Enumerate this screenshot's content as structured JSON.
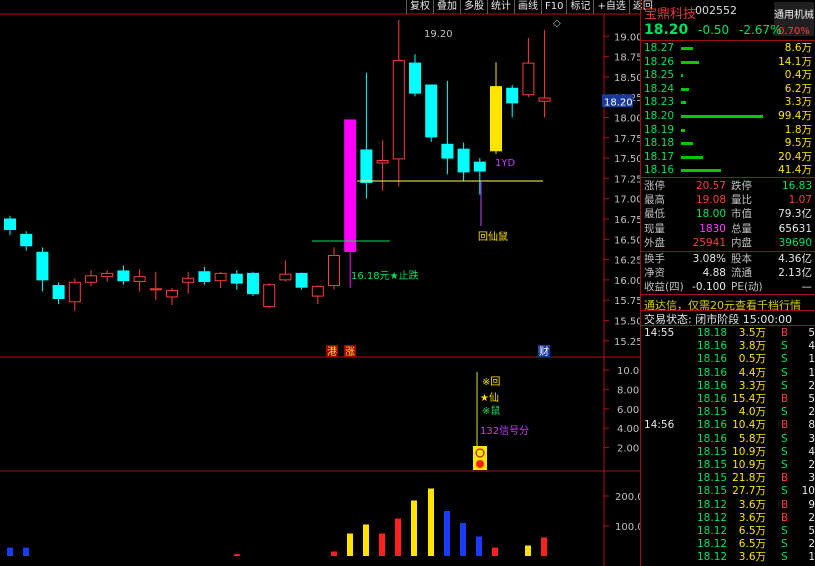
{
  "toolbar": [
    "复权",
    "叠加",
    "多股",
    "统计",
    "画线",
    "F10",
    "标记",
    "+自选",
    "返回"
  ],
  "stock": {
    "name": "宝鼎科技",
    "code": "002552",
    "sector": "通用机械",
    "sector_pct": "0.70%",
    "price": "18.20",
    "change": "-0.50",
    "change_pct": "-2.67%"
  },
  "asks": [
    {
      "label": "18.27",
      "vol": "8.6万",
      "bar": 12
    },
    {
      "label": "18.26",
      "vol": "14.1万",
      "bar": 18
    },
    {
      "label": "18.25",
      "vol": "0.4万",
      "bar": 2
    },
    {
      "label": "18.24",
      "vol": "6.2万",
      "bar": 8
    },
    {
      "label": "18.23",
      "vol": "3.3万",
      "bar": 5
    }
  ],
  "bids": [
    {
      "label": "18.20",
      "vol": "99.4万",
      "bar": 82
    },
    {
      "label": "18.19",
      "vol": "1.8万",
      "bar": 4
    },
    {
      "label": "18.18",
      "vol": "9.5万",
      "bar": 12
    },
    {
      "label": "18.17",
      "vol": "20.4万",
      "bar": 22
    },
    {
      "label": "18.16",
      "vol": "41.4万",
      "bar": 40
    }
  ],
  "stats": [
    {
      "l1": "涨停",
      "v1": "20.57",
      "c1": "rd",
      "l2": "跌停",
      "v2": "16.83",
      "c2": "gr"
    },
    {
      "l1": "最高",
      "v1": "19.08",
      "c1": "rd",
      "l2": "量比",
      "v2": "1.07",
      "c2": "rd"
    },
    {
      "l1": "最低",
      "v1": "18.00",
      "c1": "gr",
      "l2": "市值",
      "v2": "79.3亿",
      "c2": "wh"
    },
    {
      "l1": "现量",
      "v1": "1830",
      "c1": "mg",
      "l2": "总量",
      "v2": "65631",
      "c2": "wh"
    },
    {
      "l1": "外盘",
      "v1": "25941",
      "c1": "rd",
      "l2": "内盘",
      "v2": "39690",
      "c2": "gr"
    }
  ],
  "stats2": [
    {
      "l1": "换手",
      "v1": "3.08%",
      "l2": "股本",
      "v2": "4.36亿"
    },
    {
      "l1": "净资",
      "v1": "4.88",
      "l2": "流通",
      "v2": "2.13亿"
    },
    {
      "l1": "收益(四)",
      "v1": "-0.100",
      "l2": "PE(动)",
      "v2": "—"
    }
  ],
  "ad_text": "通达信，仅需20元查看千档行情",
  "trade_status": "交易状态: 闭市阶段 15:00:00",
  "ticks": [
    {
      "t": "14:55",
      "p": "18.18",
      "v": "3.5万",
      "s": "B",
      "n": "5"
    },
    {
      "t": "",
      "p": "18.16",
      "v": "3.8万",
      "s": "S",
      "n": "4"
    },
    {
      "t": "",
      "p": "18.16",
      "v": "0.5万",
      "s": "S",
      "n": "1"
    },
    {
      "t": "",
      "p": "18.16",
      "v": "4.4万",
      "s": "S",
      "n": "1"
    },
    {
      "t": "",
      "p": "18.16",
      "v": "3.3万",
      "s": "S",
      "n": "2"
    },
    {
      "t": "",
      "p": "18.16",
      "v": "15.4万",
      "s": "B",
      "n": "5"
    },
    {
      "t": "",
      "p": "18.15",
      "v": "4.0万",
      "s": "S",
      "n": "2"
    },
    {
      "t": "14:56",
      "p": "18.16",
      "v": "10.4万",
      "s": "B",
      "n": "8"
    },
    {
      "t": "",
      "p": "18.16",
      "v": "5.8万",
      "s": "S",
      "n": "3"
    },
    {
      "t": "",
      "p": "18.15",
      "v": "10.9万",
      "s": "S",
      "n": "4"
    },
    {
      "t": "",
      "p": "18.15",
      "v": "10.9万",
      "s": "S",
      "n": "2"
    },
    {
      "t": "",
      "p": "18.15",
      "v": "21.8万",
      "s": "B",
      "n": "3"
    },
    {
      "t": "",
      "p": "18.15",
      "v": "27.7万",
      "s": "S",
      "n": "10"
    },
    {
      "t": "",
      "p": "18.12",
      "v": "3.6万",
      "s": "B",
      "n": "9"
    },
    {
      "t": "",
      "p": "18.12",
      "v": "3.6万",
      "s": "B",
      "n": "2"
    },
    {
      "t": "",
      "p": "18.12",
      "v": "6.5万",
      "s": "S",
      "n": "5"
    },
    {
      "t": "",
      "p": "18.12",
      "v": "6.5万",
      "s": "S",
      "n": "2"
    },
    {
      "t": "",
      "p": "18.12",
      "v": "3.6万",
      "s": "S",
      "n": "1"
    }
  ],
  "chart_data": {
    "type": "candlestick",
    "y_ticks": [
      "19.00",
      "18.75",
      "18.50",
      "18.25",
      "18.00",
      "17.75",
      "17.50",
      "17.25",
      "17.00",
      "16.75",
      "16.50",
      "16.25",
      "16.00",
      "15.75",
      "15.50",
      "15.25"
    ],
    "y_range": [
      15.05,
      19.25
    ],
    "last_price_label": "18.20",
    "candles": [
      {
        "o": 16.75,
        "c": 16.62,
        "h": 16.79,
        "l": 16.55,
        "up": false
      },
      {
        "o": 16.56,
        "c": 16.42,
        "h": 16.6,
        "l": 16.36,
        "up": false
      },
      {
        "o": 16.34,
        "c": 16.0,
        "h": 16.4,
        "l": 15.86,
        "up": false
      },
      {
        "o": 15.93,
        "c": 15.77,
        "h": 15.97,
        "l": 15.7,
        "up": false
      },
      {
        "o": 15.73,
        "c": 15.97,
        "h": 16.02,
        "l": 15.62,
        "up": true
      },
      {
        "o": 15.97,
        "c": 16.05,
        "h": 16.12,
        "l": 15.92,
        "up": true
      },
      {
        "o": 16.04,
        "c": 16.08,
        "h": 16.12,
        "l": 15.98,
        "up": true
      },
      {
        "o": 16.11,
        "c": 15.99,
        "h": 16.18,
        "l": 15.94,
        "up": false
      },
      {
        "o": 15.98,
        "c": 16.04,
        "h": 16.13,
        "l": 15.86,
        "up": true
      },
      {
        "o": 15.88,
        "c": 15.89,
        "h": 16.1,
        "l": 15.75,
        "up": true
      },
      {
        "o": 15.79,
        "c": 15.87,
        "h": 15.9,
        "l": 15.69,
        "up": true
      },
      {
        "o": 15.97,
        "c": 16.02,
        "h": 16.1,
        "l": 15.83,
        "up": true
      },
      {
        "o": 16.1,
        "c": 15.98,
        "h": 16.16,
        "l": 15.94,
        "up": false
      },
      {
        "o": 15.99,
        "c": 16.08,
        "h": 16.1,
        "l": 15.9,
        "up": true
      },
      {
        "o": 16.07,
        "c": 15.96,
        "h": 16.12,
        "l": 15.88,
        "up": false
      },
      {
        "o": 16.08,
        "c": 15.83,
        "h": 16.1,
        "l": 15.8,
        "up": false
      },
      {
        "o": 15.67,
        "c": 15.94,
        "h": 15.96,
        "l": 15.65,
        "up": true
      },
      {
        "o": 16.0,
        "c": 16.07,
        "h": 16.24,
        "l": 15.98,
        "up": true
      },
      {
        "o": 16.08,
        "c": 15.91,
        "h": 16.09,
        "l": 15.88,
        "up": false
      },
      {
        "o": 15.8,
        "c": 15.92,
        "h": 15.93,
        "l": 15.7,
        "up": true
      },
      {
        "o": 15.93,
        "c": 16.3,
        "h": 16.4,
        "l": 15.88,
        "up": true
      },
      {
        "o": 16.35,
        "c": 17.97,
        "h": 17.97,
        "l": 15.9,
        "up": true,
        "limit": true
      },
      {
        "o": 17.6,
        "c": 17.2,
        "h": 18.55,
        "l": 17.0,
        "up": false
      },
      {
        "o": 17.47,
        "c": 17.44,
        "h": 17.72,
        "l": 17.1,
        "up": true
      },
      {
        "o": 17.49,
        "c": 18.7,
        "h": 19.2,
        "l": 17.15,
        "up": true
      },
      {
        "o": 18.67,
        "c": 18.3,
        "h": 18.78,
        "l": 18.26,
        "up": false
      },
      {
        "o": 18.4,
        "c": 17.76,
        "h": 18.4,
        "l": 17.7,
        "up": false
      },
      {
        "o": 17.67,
        "c": 17.5,
        "h": 18.45,
        "l": 17.3,
        "up": false
      },
      {
        "o": 17.61,
        "c": 17.33,
        "h": 17.69,
        "l": 17.22,
        "up": false
      },
      {
        "o": 17.45,
        "c": 17.34,
        "h": 17.5,
        "l": 17.05,
        "up": false
      },
      {
        "o": 17.59,
        "c": 18.38,
        "h": 18.68,
        "l": 17.55,
        "up": true,
        "yellow": true
      },
      {
        "o": 18.36,
        "c": 18.18,
        "h": 18.4,
        "l": 18.0,
        "up": false
      },
      {
        "o": 18.28,
        "c": 18.67,
        "h": 18.98,
        "l": 18.25,
        "up": true
      },
      {
        "o": 18.2,
        "c": 18.24,
        "h": 19.08,
        "l": 18.0,
        "up": true
      }
    ],
    "annotations": [
      {
        "text": "19.20",
        "color": "#c0c0c0"
      },
      {
        "text": "1YD",
        "color": "#c040ff"
      },
      {
        "text": "回仙鼠",
        "color": "#ffe400"
      },
      {
        "text": "16.18元★止跌",
        "color": "#00e060"
      }
    ],
    "markers": [
      "港",
      "涨",
      "财"
    ],
    "signal": {
      "y_ticks": [
        "10.00",
        "8.00",
        "6.00",
        "4.00",
        "2.00"
      ],
      "labels": [
        "※回",
        "★仙",
        "※鼠",
        "132信号分"
      ]
    },
    "volume": {
      "y_ticks": [
        "200.0",
        "100.0"
      ],
      "bars": [
        {
          "v": 28,
          "c": "#1a3cff"
        },
        {
          "v": 28,
          "c": "#1a3cff"
        },
        {
          "v": 6,
          "c": "#ff2020"
        },
        {
          "v": 15,
          "c": "#ff2020"
        },
        {
          "v": 75,
          "c": "#ffe400"
        },
        {
          "v": 105,
          "c": "#ffe400"
        },
        {
          "v": 75,
          "c": "#ff2020"
        },
        {
          "v": 125,
          "c": "#ff2020"
        },
        {
          "v": 185,
          "c": "#ffe400"
        },
        {
          "v": 225,
          "c": "#ffe400"
        },
        {
          "v": 150,
          "c": "#1a3cff"
        },
        {
          "v": 110,
          "c": "#1a3cff"
        },
        {
          "v": 65,
          "c": "#1a3cff"
        },
        {
          "v": 28,
          "c": "#ff2020"
        },
        {
          "v": 35,
          "c": "#ffe400"
        },
        {
          "v": 62,
          "c": "#ff2020"
        }
      ]
    }
  }
}
